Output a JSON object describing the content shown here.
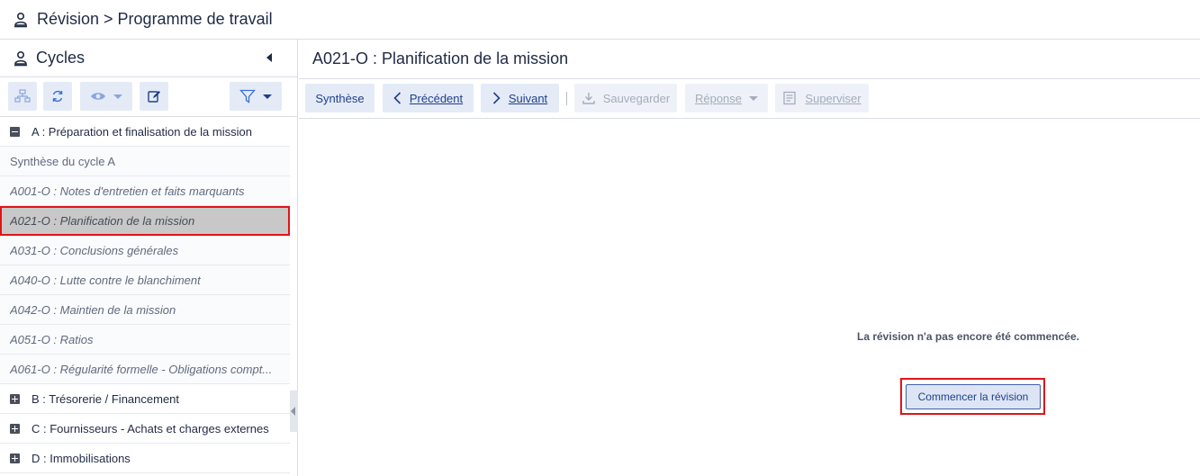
{
  "header": {
    "breadcrumb": "Révision > Programme de travail"
  },
  "sidebar": {
    "title": "Cycles",
    "groups": [
      {
        "label": "A : Préparation et finalisation de la mission",
        "expanded": true
      },
      {
        "label": "B : Trésorerie / Financement",
        "expanded": false
      },
      {
        "label": "C : Fournisseurs - Achats et charges externes",
        "expanded": false
      },
      {
        "label": "D : Immobilisations",
        "expanded": false
      }
    ],
    "items": [
      {
        "label": "Synthèse du cycle A"
      },
      {
        "label": "A001-O : Notes d'entretien et faits marquants"
      },
      {
        "label": "A021-O : Planification de la mission",
        "selected": true
      },
      {
        "label": "A031-O : Conclusions générales"
      },
      {
        "label": "A040-O : Lutte contre le blanchiment"
      },
      {
        "label": "A042-O : Maintien de la mission"
      },
      {
        "label": "A051-O : Ratios"
      },
      {
        "label": "A061-O : Régularité formelle - Obligations compt..."
      }
    ]
  },
  "main": {
    "title": "A021-O : Planification de la mission",
    "toolbar": {
      "synthese": "Synthèse",
      "precedent": "Précédent",
      "suivant": "Suivant",
      "sauvegarder": "Sauvegarder",
      "reponse": "Réponse",
      "superviser": "Superviser"
    },
    "message": "La révision n'a pas encore été commencée.",
    "start_button": "Commencer la révision"
  },
  "colors": {
    "accent": "#3b6fd4",
    "highlight": "#e0141a",
    "selected_row": "#c8c8c8"
  }
}
